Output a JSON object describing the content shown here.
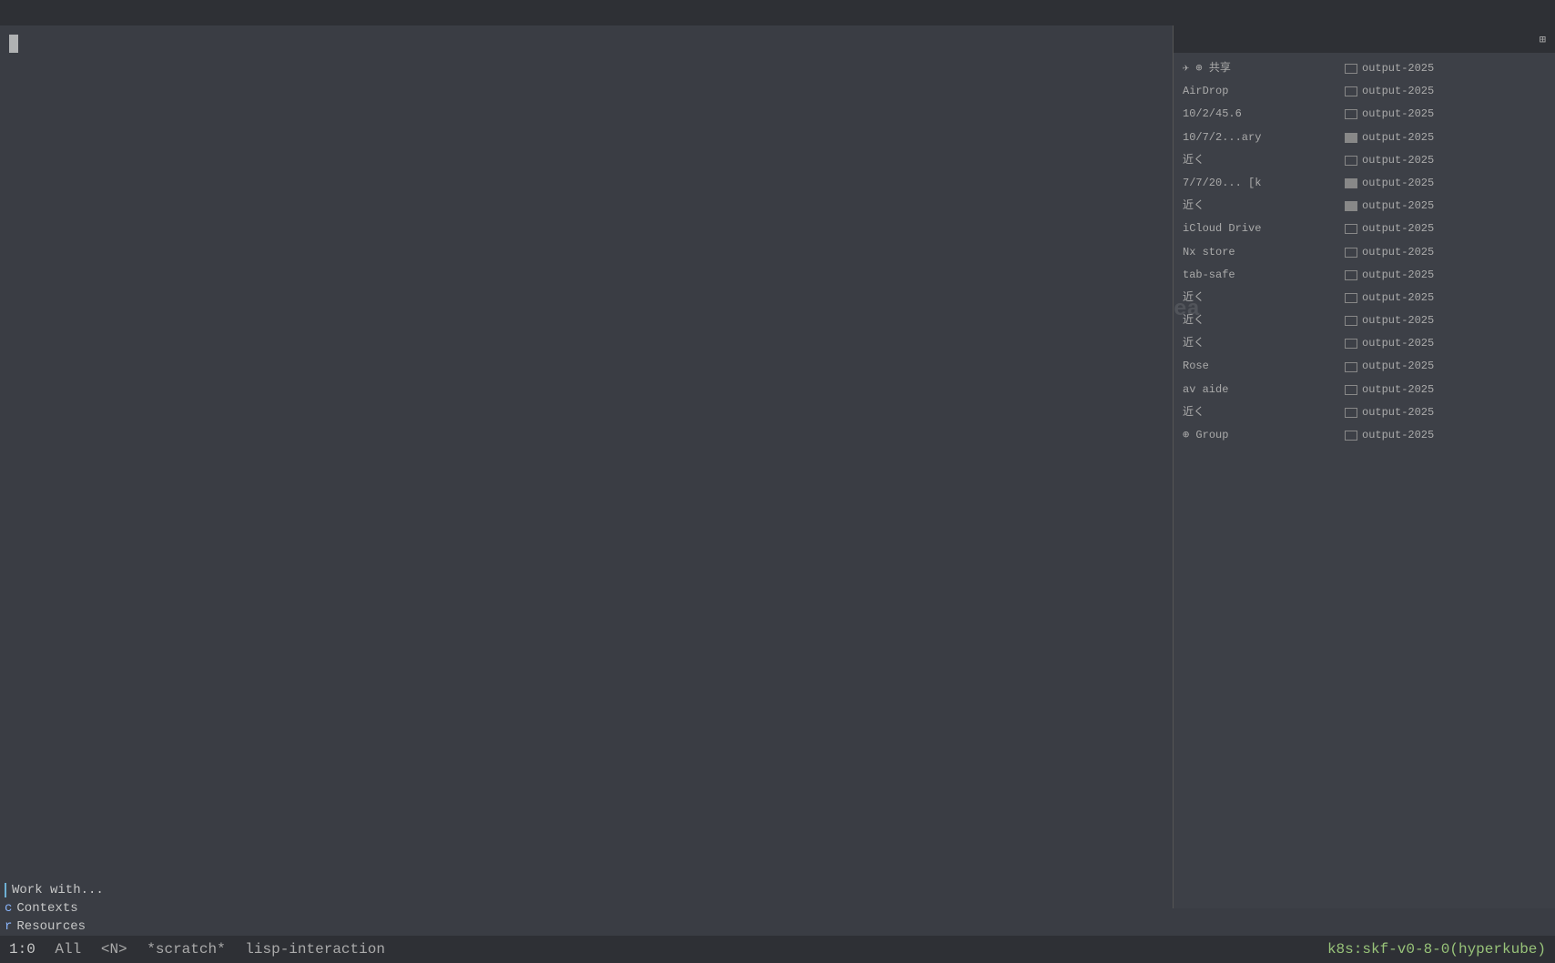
{
  "titleBar": {
    "label": ""
  },
  "topRight": {
    "items": [
      "⌘",
      "⇧⌘"
    ]
  },
  "rightPanel": {
    "header": "⊞",
    "folderItems": [
      {
        "label": "✈ ⊕ 共享",
        "highlighted": false
      },
      {
        "label": "AirDrop",
        "highlighted": false
      },
      {
        "label": "10/2/45.6",
        "highlighted": false
      },
      {
        "label": "10/7/2...ary",
        "highlighted": false
      },
      {
        "label": "近く",
        "highlighted": false
      },
      {
        "label": "7/7/20... [k",
        "highlighted": false
      },
      {
        "label": "近く",
        "highlighted": false
      },
      {
        "label": "iCloud Drive",
        "highlighted": false
      },
      {
        "label": "Nx store",
        "highlighted": false
      },
      {
        "label": "tab-safe",
        "highlighted": false
      },
      {
        "label": "近く",
        "highlighted": false
      },
      {
        "label": "近く",
        "highlighted": false
      },
      {
        "label": "近く",
        "highlighted": false
      },
      {
        "label": "Rose",
        "highlighted": false
      },
      {
        "label": "av aide",
        "highlighted": false
      },
      {
        "label": "近く",
        "highlighted": false
      },
      {
        "label": "⊕ Group",
        "highlighted": false
      }
    ],
    "outputItems": [
      {
        "label": "output-2025",
        "filled": false
      },
      {
        "label": "output-2025",
        "filled": false
      },
      {
        "label": "output-2025",
        "filled": false
      },
      {
        "label": "output-2025",
        "filled": true
      },
      {
        "label": "output-2025",
        "filled": false
      },
      {
        "label": "output-2025",
        "filled": true
      },
      {
        "label": "output-2025",
        "filled": true
      },
      {
        "label": "output-2025",
        "filled": false
      },
      {
        "label": "output-2025",
        "filled": false
      },
      {
        "label": "output-2025",
        "filled": false
      },
      {
        "label": "output-2025",
        "filled": false
      },
      {
        "label": "output-2025",
        "filled": false
      },
      {
        "label": "output-2025",
        "filled": false
      },
      {
        "label": "output-2025",
        "filled": false
      },
      {
        "label": "output-2025",
        "filled": false
      },
      {
        "label": "output-2025",
        "filled": false
      },
      {
        "label": "output-2025",
        "filled": false
      }
    ]
  },
  "workWithMenu": {
    "title": "Work with...",
    "items": [
      {
        "key": "c",
        "label": "Contexts"
      },
      {
        "key": "r",
        "label": "Resources"
      }
    ]
  },
  "statusBar": {
    "position": "1:0",
    "scroll": "All",
    "mode": "<N>",
    "buffer": "*scratch*",
    "major": "lisp-interaction",
    "k8s": "k8s:skf-v0-8-0(hyperkube)"
  },
  "eaText": "ea"
}
